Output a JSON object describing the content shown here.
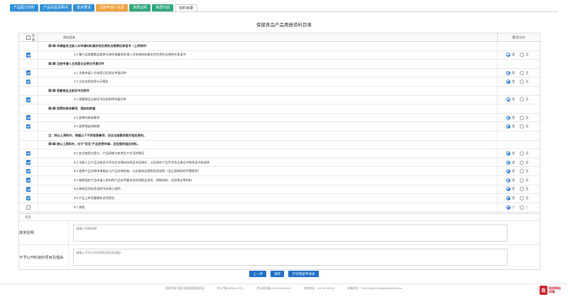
{
  "tabs": [
    {
      "label": "产品配方材料",
      "style": "blue"
    },
    {
      "label": "产品标签说明书",
      "style": "blue"
    },
    {
      "label": "技术要求",
      "style": "blue"
    },
    {
      "label": "注册申请人信息",
      "style": "orange"
    },
    {
      "label": "资质证照",
      "style": "green"
    },
    {
      "label": "资质内容",
      "style": "green"
    },
    {
      "label": "资料目录",
      "style": "active"
    }
  ],
  "document": {
    "title": "保健食品产品再册资料目录"
  },
  "table": {
    "select_all_label": "全选",
    "col_directory": "资料目录",
    "col_public": "是/否公开",
    "yes_label": "是",
    "no_label": "否",
    "rows": [
      {
        "type": "section",
        "text": "第1章 申请备发注册人对申请材料真实性负责的法律责任承诺书（上传附件）"
      },
      {
        "type": "item",
        "text": "1.1 集产品保健食品变更注册申请备案申请人对申请材料真实性负责的法律责任承诺书",
        "checked": true,
        "public": "yes"
      },
      {
        "type": "section",
        "text": "第2章 注册申请人主体登记证明文件复印件"
      },
      {
        "type": "item",
        "text": "2.1 注册申请人主体登记证明文件复印件",
        "checked": true,
        "public": "yes"
      },
      {
        "type": "item",
        "text": "2.2 企业信用信息公示报告",
        "checked": true,
        "public": "yes"
      },
      {
        "type": "section",
        "text": "第3章 保健食品注册证书及附件"
      },
      {
        "type": "item",
        "text": "3.1 保健食品注册证书及其附件的复印件",
        "checked": true,
        "public": "yes"
      },
      {
        "type": "section",
        "text": "第4章 变更的具体事项、理由和依据"
      },
      {
        "type": "item",
        "text": "4.1 变更的具体事项",
        "checked": true,
        "public": "yes"
      },
      {
        "type": "item",
        "text": "4.2 变更理由和依据",
        "checked": true,
        "public": "yes"
      },
      {
        "type": "note",
        "text": "注：除以上资料外，根据以下不同变更事项，还应当按要求提交相应资料。"
      },
      {
        "type": "section",
        "text": "第5章 除以上资料外，对于\"双无\"产品变更申请，还应提供相应材料。"
      },
      {
        "type": "item",
        "text": "5.1 安全使用方面与、产品研制与有关生产许可的情况",
        "checked": true,
        "public": "yes"
      },
      {
        "type": "item",
        "text": "5.2 注册人已产品注册证书不存在法律纠纷承诺书及境外，以及境外产品不涉及注册证书和承诺书的说明",
        "checked": true,
        "public": "yes"
      },
      {
        "type": "item",
        "text": "5.3 变更产品名称申请报告与产品名称核查，以及查询无侵权信息说明（无正面商标的不需提供）",
        "checked": true,
        "public": "yes"
      },
      {
        "type": "item",
        "text": "5.4 按照相应产品申请人资料的产品技术要求及检验报告资料、研制材料、试验报告等材料",
        "checked": true,
        "public": "yes"
      },
      {
        "type": "item",
        "text": "5.5 修改后的标签说明书及修订说明",
        "checked": true,
        "public": "yes"
      },
      {
        "type": "item",
        "text": "5.6 产品上市后健康安全性报告",
        "checked": true,
        "public": "yes"
      },
      {
        "type": "item",
        "text": "5.7 其他",
        "checked": false,
        "public": "yes",
        "dim": true
      }
    ]
  },
  "form": {
    "header": "项目",
    "other_label": "其他说明",
    "other_placeholder": "请输入其他说明",
    "nonpublic_label": "不予公开的资料项目及理由",
    "nonpublic_placeholder": "请输入不予公开的资料项目及理由"
  },
  "buttons": {
    "prev": "上一步",
    "save": "保存",
    "print": "打印预览申请表"
  },
  "footer": {
    "item1": "版权所有 国家市场监督管理总局",
    "item2": "京ICP备18052442号-1",
    "item3": "京公网安备11010202008101",
    "item4": "咨询电话：010-82782241",
    "item5": "邮箱地址：532224@9225@bjfgcw@163.com"
  },
  "logo": {
    "mark": "政",
    "line1": "政府网站",
    "line2": "找错"
  },
  "colors": {
    "tab_blue": "#2e8fd6",
    "tab_orange": "#f0a23d",
    "tab_green": "#2ea77a",
    "button": "#1f6fc9",
    "check": "#2e7fd6"
  }
}
